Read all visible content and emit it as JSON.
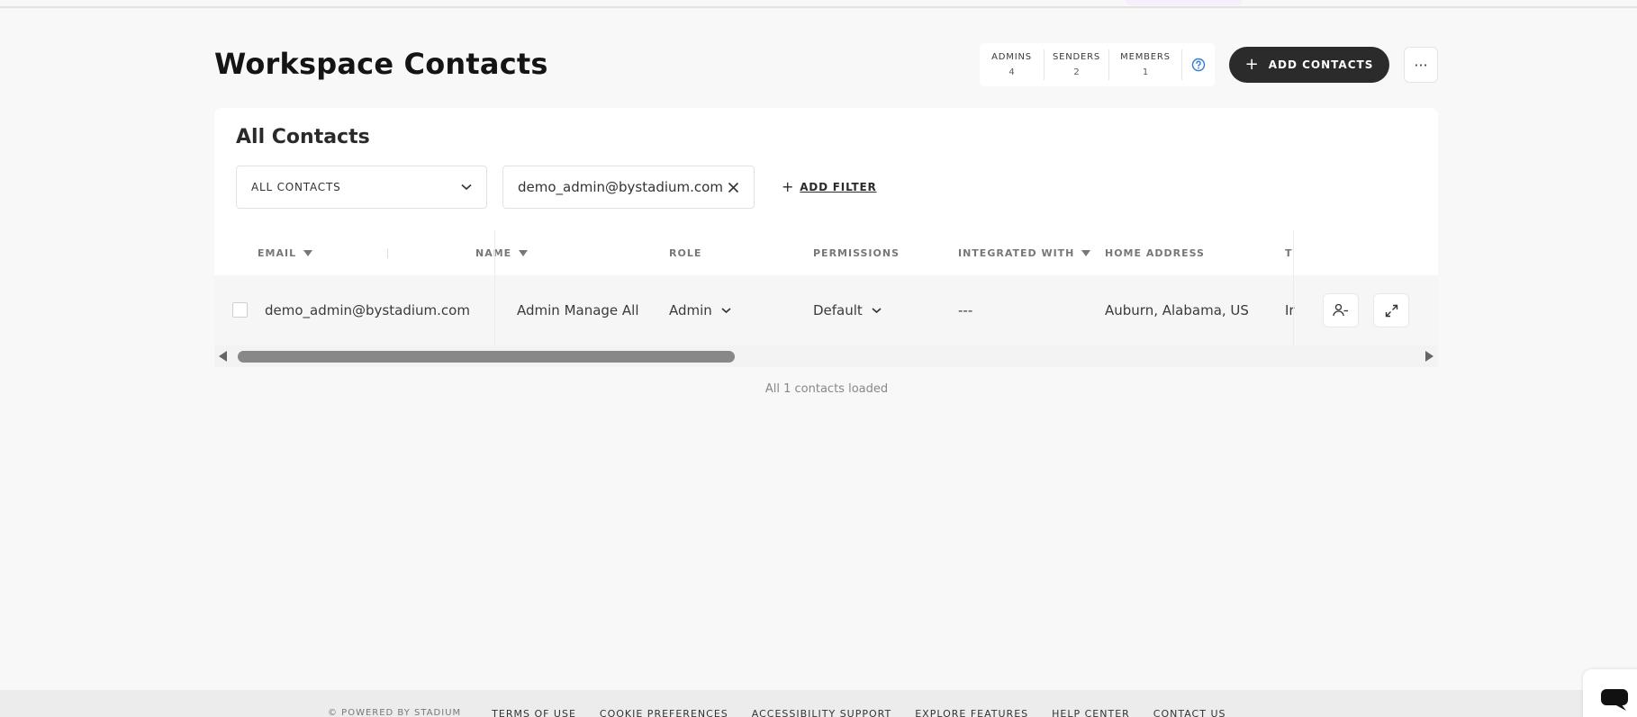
{
  "page": {
    "title": "Workspace Contacts"
  },
  "stats": [
    {
      "label": "ADMINS",
      "value": "4"
    },
    {
      "label": "SENDERS",
      "value": "2"
    },
    {
      "label": "MEMBERS",
      "value": "1"
    }
  ],
  "header": {
    "add_contacts_label": "ADD CONTACTS",
    "more_label": "···"
  },
  "card": {
    "title": "All Contacts"
  },
  "filters": {
    "segment_value": "ALL CONTACTS",
    "active_filter": "demo_admin@bystadium.com",
    "add_filter_label": "ADD FILTER"
  },
  "table": {
    "columns": {
      "email": "EMAIL",
      "name": "NAME",
      "role": "ROLE",
      "permissions": "PERMISSIONS",
      "integrated_with": "INTEGRATED WITH",
      "home_address": "HOME ADDRESS",
      "next": "T"
    },
    "rows": [
      {
        "email": "demo_admin@bystadium.com",
        "name": "Admin Manage All",
        "role": "Admin",
        "permissions": "Default",
        "integrated_with": "---",
        "home_address": "Auburn, Alabama, US",
        "next": "Ir"
      }
    ]
  },
  "status": {
    "loaded_text": "All 1 contacts loaded"
  },
  "footer": {
    "powered": "© POWERED BY STADIUM",
    "links": [
      "TERMS OF USE",
      "COOKIE PREFERENCES",
      "ACCESSIBILITY SUPPORT",
      "EXPLORE FEATURES",
      "HELP CENTER",
      "CONTACT US"
    ]
  },
  "colors": {
    "primary_button": "#2b2b2b",
    "help_icon": "#2f7fd1",
    "background": "#f8f8f8"
  }
}
